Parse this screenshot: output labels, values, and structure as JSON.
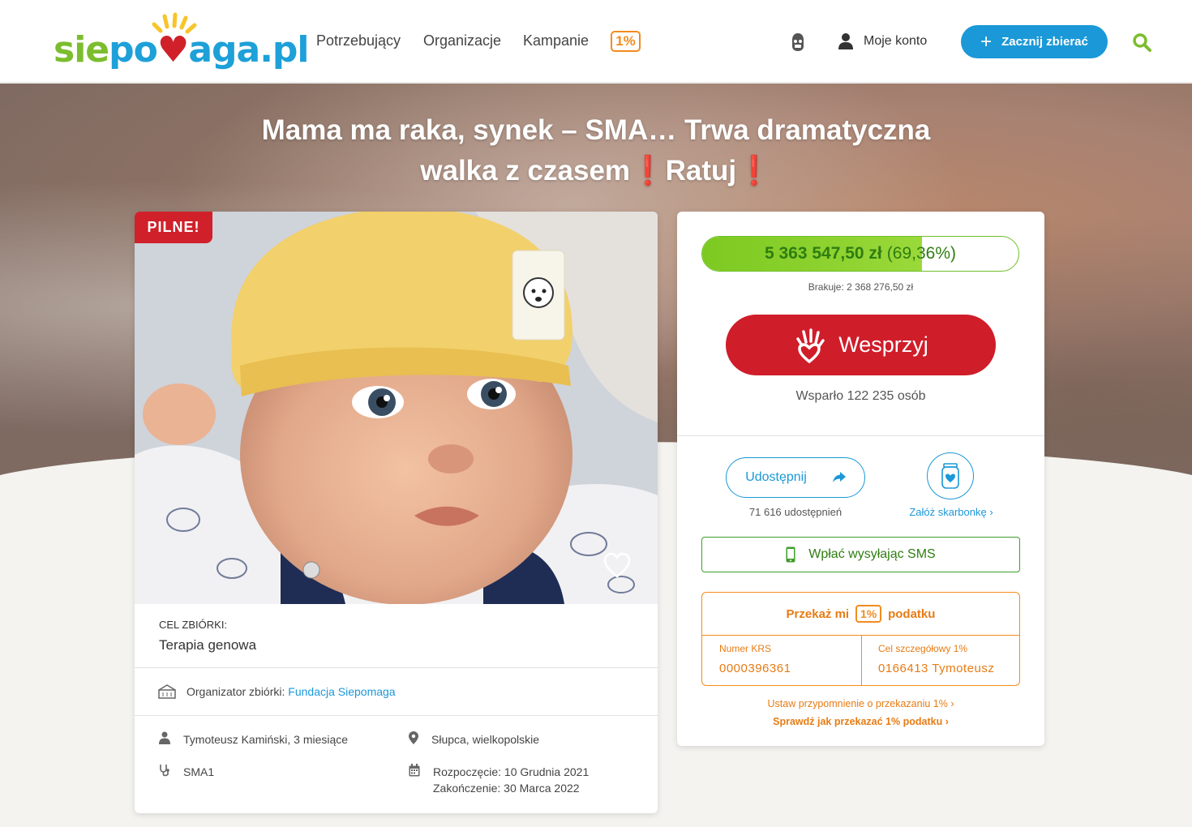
{
  "header": {
    "logo": "siepomaga.pl",
    "nav": [
      "Potrzebujący",
      "Organizacje",
      "Kampanie"
    ],
    "one_percent": "1%",
    "account_label": "Moje konto",
    "cta_label": "Zacznij zbierać",
    "colors": {
      "brand_blue": "#1b98d7",
      "brand_green": "#7cbd2e",
      "orange": "#f28c1e"
    }
  },
  "campaign": {
    "title_line1": "Mama ma raka, synek – SMA… Trwa dramatyczna",
    "title_line2_a": "walka z czasem",
    "title_line2_b": "Ratuj",
    "urgent_badge": "PILNE!",
    "goal_label": "CEL ZBIÓRKI:",
    "goal_value": "Terapia genowa",
    "organizer_label": "Organizator zbiórki:",
    "organizer_name": "Fundacja Siepomaga",
    "beneficiary": "Tymoteusz Kamiński, 3 miesiące",
    "location": "Słupca, wielkopolskie",
    "disease": "SMA1",
    "start": "Rozpoczęcie: 10 Grudnia 2021",
    "end": "Zakończenie: 30 Marca 2022"
  },
  "donation": {
    "amount": "5 363 547,50 zł",
    "percent_text": "(69,36%)",
    "progress_fraction": 0.6936,
    "missing": "Brakuje: 2 368 276,50 zł",
    "support_label": "Wesprzyj",
    "supporters": "Wsparło 122 235 osób",
    "share_label": "Udostępnij",
    "share_count": "71 616 udostępnień",
    "piggy_label": "Załóż skarbonkę",
    "sms_label": "Wpłać wysyłając SMS",
    "tax_title_a": "Przekaż mi",
    "tax_title_b": "podatku",
    "krs_label": "Numer KRS",
    "krs_value": "0000396361",
    "goal1_label": "Cel szczegółowy 1%",
    "goal1_value": "0166413 Tymoteusz",
    "reminder_link": "Ustaw przypomnienie o przekazaniu 1%",
    "how_link": "Sprawdź jak przekazać 1% podatku"
  }
}
